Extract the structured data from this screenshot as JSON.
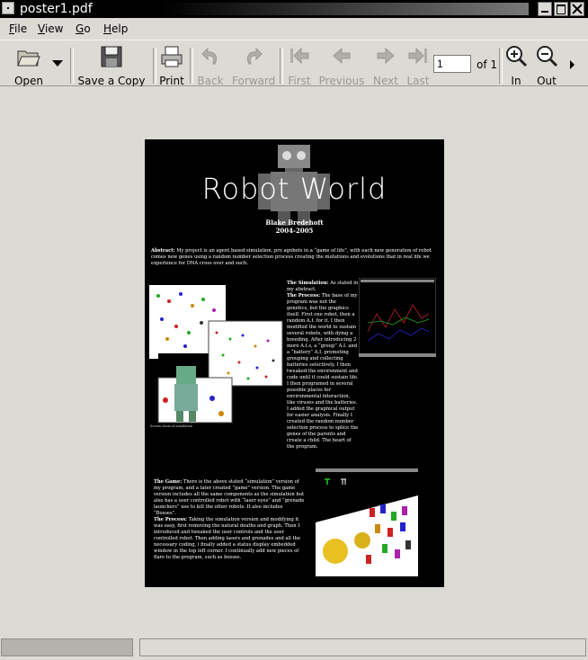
{
  "window": {
    "title": "poster1.pdf"
  },
  "menubar": {
    "items": [
      {
        "underline": "F",
        "rest": "ile"
      },
      {
        "underline": "V",
        "rest": "iew"
      },
      {
        "underline": "G",
        "rest": "o"
      },
      {
        "underline": "H",
        "rest": "elp"
      }
    ]
  },
  "toolbar": {
    "open": "Open",
    "save_copy": "Save a Copy",
    "print": "Print",
    "back": "Back",
    "forward": "Forward",
    "first": "First",
    "previous": "Previous",
    "next": "Next",
    "last": "Last",
    "page_value": "1",
    "page_of": "of 1",
    "zoom_in": "In",
    "zoom_out": "Out"
  },
  "poster": {
    "title": "Robot World",
    "author": "Blake Bredehoft",
    "years": "2004-2005",
    "abstract_head": "Abstract:",
    "abstract": " My project is an agent based simulation, pro agnbots in a “game of life”, with each new generation of robot comes new genes using a random number selection process creating the mutations and evolutions that in real life we experience for DNA cross over and such.",
    "sim_head": "The Simulation:",
    "sim_text": " As stated in my abstract.",
    "process_head": "The Process:",
    "process_text": " The base of my program was not the genetics, but the graphics itself. First one robot, then a random A.I. for it. I then modified the world to sustain several robots, with dying a breeding. After introducing 2 more A.I.s, a “group” A.I. and a “battery” A.I. promoting grouping and collecting batteries selectively. I then tweaked the environment and code until it could sustain life. I then programed in several possible places for environmental interaction, like viruses and the batteries. I added the graphical output for easier analysis. Finally I created the random number selection process to splice the genes of the parents and create a child. The heart of the program.",
    "game_head": "The Game:",
    "game_text": " There is the above stated “simulation” version of my program, and a later created “game” version. The game version includes all the same components as the simulation but also has a user controlled robot with “laser eyes” and “grenade launchers” use to kill the other robots. It also includes “Bosses”.",
    "game_process_head": "The Process:",
    "game_process_text": " Taking the simulation version and modifying it was easy, first removing the natural deaths and graph. Then I introduced and tweaked the user controls and the user controlled robot. Then adding lasers and grenades and all the necessary coding, i finally added a status display embedded window in the top left corner. I continually add new pieces of flare to the program, such as bosses.",
    "caption": "Screen shots of simulation"
  }
}
